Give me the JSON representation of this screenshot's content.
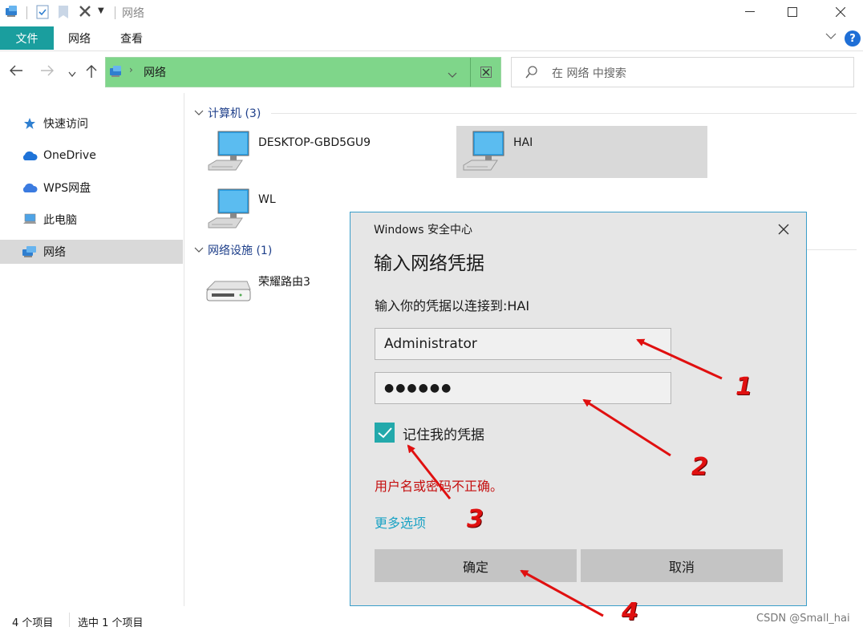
{
  "window": {
    "title": "网络"
  },
  "ribbon": {
    "tabs": [
      "文件",
      "网络",
      "查看"
    ],
    "help_label": "?"
  },
  "address": {
    "path_label": "网络",
    "search_placeholder": "在 网络 中搜索",
    "highlight_color": "#7fd68a"
  },
  "sidebar": {
    "items": [
      {
        "label": "快速访问",
        "icon": "star-icon"
      },
      {
        "label": "OneDrive",
        "icon": "cloud-icon"
      },
      {
        "label": "WPS网盘",
        "icon": "cloud-icon"
      },
      {
        "label": "此电脑",
        "icon": "pc-icon"
      },
      {
        "label": "网络",
        "icon": "network-icon",
        "selected": true
      }
    ]
  },
  "content": {
    "groups": [
      {
        "title": "计算机 (3)",
        "items": [
          "DESKTOP-GBD5GU9",
          "HAI",
          "WL"
        ],
        "selected": "HAI"
      },
      {
        "title": "网络设施 (1)",
        "items": [
          "荣耀路由3"
        ]
      }
    ]
  },
  "status": {
    "count": "4 个项目",
    "selection": "选中 1 个项目"
  },
  "dialog": {
    "caption": "Windows 安全中心",
    "title": "输入网络凭据",
    "prompt": "输入你的凭据以连接到:HAI",
    "username": "Administrator",
    "password_mask": "●●●●●●",
    "remember_label": "记住我的凭据",
    "remember_checked": true,
    "error": "用户名或密码不正确。",
    "more_options": "更多选项",
    "ok_label": "确定",
    "cancel_label": "取消",
    "accent_color": "#23a9ab",
    "error_color": "#c50f0f"
  },
  "annotations": [
    "1",
    "2",
    "3",
    "4"
  ],
  "watermark": "CSDN @Small_hai"
}
